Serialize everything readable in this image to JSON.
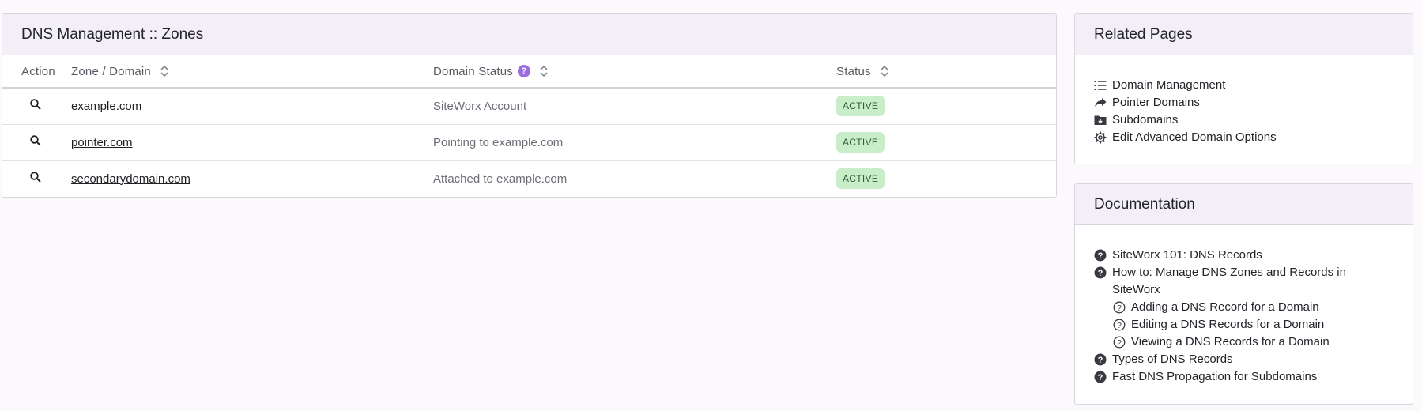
{
  "main": {
    "title": "DNS Management :: Zones",
    "columns": {
      "action": "Action",
      "zone": "Zone / Domain",
      "domain_status": "Domain Status",
      "status": "Status"
    },
    "rows": [
      {
        "zone": "example.com",
        "domain_status": "SiteWorx Account",
        "status": "ACTIVE"
      },
      {
        "zone": "pointer.com",
        "domain_status": "Pointing to example.com",
        "status": "ACTIVE"
      },
      {
        "zone": "secondarydomain.com",
        "domain_status": "Attached to example.com",
        "status": "ACTIVE"
      }
    ]
  },
  "related": {
    "title": "Related Pages",
    "items": [
      {
        "label": "Domain Management",
        "icon": "list-icon"
      },
      {
        "label": "Pointer Domains",
        "icon": "arrow-icon"
      },
      {
        "label": "Subdomains",
        "icon": "folder-download-icon"
      },
      {
        "label": "Edit Advanced Domain Options",
        "icon": "gear-icon"
      }
    ]
  },
  "docs": {
    "title": "Documentation",
    "items": [
      {
        "label": "SiteWorx 101: DNS Records",
        "icon": "help-filled-icon"
      },
      {
        "label": "How to: Manage DNS Zones and Records in SiteWorx",
        "icon": "help-filled-icon"
      },
      {
        "label": "Adding a DNS Record for a Domain",
        "icon": "help-outline-icon"
      },
      {
        "label": "Editing a DNS Records for a Domain",
        "icon": "help-outline-icon"
      },
      {
        "label": "Viewing a DNS Records for a Domain",
        "icon": "help-outline-icon"
      },
      {
        "label": "Types of DNS Records",
        "icon": "help-filled-icon"
      },
      {
        "label": "Fast DNS Propagation for Subdomains",
        "icon": "help-filled-icon"
      }
    ]
  },
  "colors": {
    "header_bg": "#f3eff6",
    "badge_bg": "#c9ecc9",
    "badge_text": "#2c5d2c",
    "accent": "#9b6ce0"
  }
}
